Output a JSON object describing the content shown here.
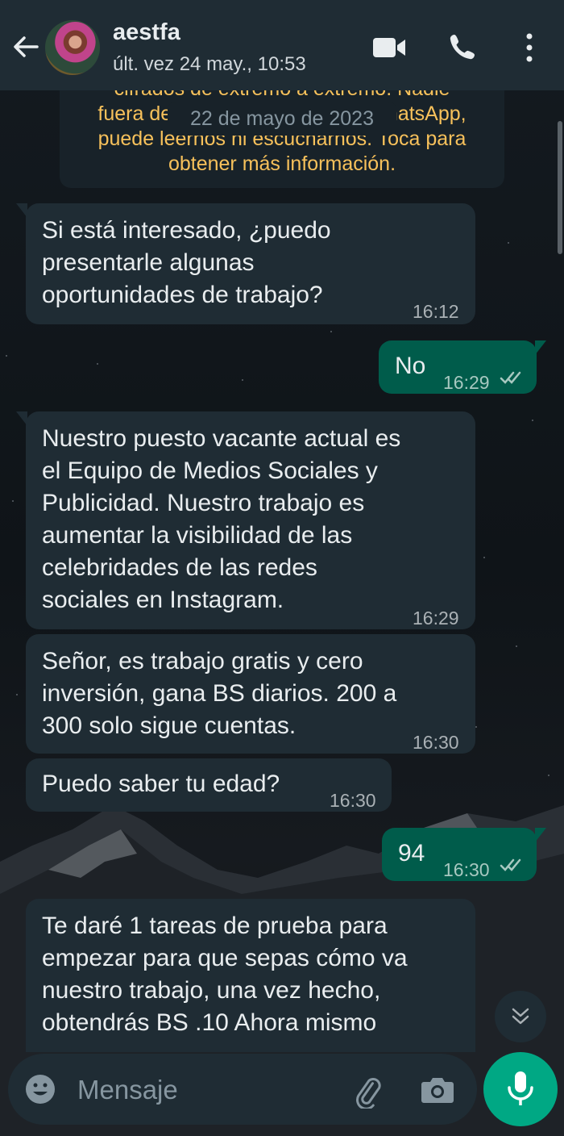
{
  "header": {
    "contact_name": "aestfa",
    "last_seen": "últ. vez 24 may., 10:53"
  },
  "encryption_notice": {
    "partial_line": "cifrados de extremo a extremo. Nadie",
    "text_lines": [
      "fuera de este chat, ni siquiera WhatsApp,",
      "puede leernos ni escucharnos. Toca para",
      "obtener más información."
    ]
  },
  "date_chip": "22 de mayo de 2023",
  "messages": [
    {
      "direction": "in",
      "lines": [
        "Si está interesado, ¿puedo",
        "presentarle algunas",
        "oportunidades de trabajo?"
      ],
      "time": "16:12"
    },
    {
      "direction": "out",
      "lines": [
        "No"
      ],
      "time": "16:29",
      "status": "read"
    },
    {
      "direction": "in",
      "lines": [
        "Nuestro puesto vacante actual es",
        "el Equipo de Medios Sociales y",
        "Publicidad. Nuestro trabajo es",
        "aumentar la visibilidad de las",
        "celebridades de las redes",
        "sociales en Instagram."
      ],
      "time": "16:29"
    },
    {
      "direction": "in",
      "lines": [
        "Señor, es trabajo gratis y cero",
        "inversión, gana BS diarios. 200 a",
        "300 solo sigue cuentas."
      ],
      "time": "16:30"
    },
    {
      "direction": "in",
      "lines": [
        "Puedo saber tu edad?"
      ],
      "time": "16:30"
    },
    {
      "direction": "out",
      "lines": [
        "94"
      ],
      "time": "16:30",
      "status": "read"
    },
    {
      "direction": "in",
      "lines": [
        "Te daré 1 tareas de prueba para",
        "empezar para que sepas cómo va",
        "nuestro trabajo, una vez hecho,",
        "obtendrás BS .10 Ahora mismo"
      ],
      "time": ""
    }
  ],
  "input": {
    "placeholder": "Mensaje",
    "value": ""
  },
  "colors": {
    "header_bg": "#1f2c34",
    "incoming_bubble": "#1f2c34",
    "outgoing_bubble": "#005c4b",
    "notice_text": "#f7c15b",
    "accent": "#00a884"
  },
  "icons": {
    "back": "arrow-left-icon",
    "video": "video-camera-icon",
    "call": "phone-icon",
    "menu": "more-vertical-icon",
    "read_status": "double-check-icon",
    "scroll_down": "double-chevron-down-icon",
    "emoji": "emoji-icon",
    "attach": "paperclip-icon",
    "camera": "camera-icon",
    "mic": "microphone-icon"
  }
}
